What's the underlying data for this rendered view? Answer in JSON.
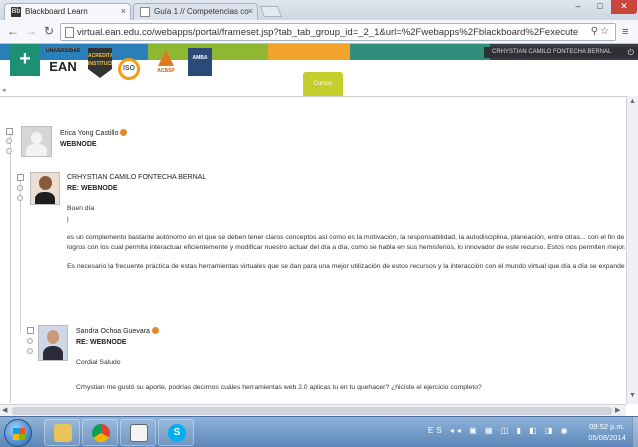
{
  "browser": {
    "tabs": [
      {
        "label": "Blackboard Learn",
        "icon": "bb-favicon"
      },
      {
        "label": "Guía 1 // Competencias co",
        "icon": "page-favicon"
      }
    ],
    "url": "virtual.ean.edu.co/webapps/portal/frameset.jsp?tab_tab_group_id=_2_1&url=%2Fwebapps%2Fblackboard%2Fexecute",
    "window_controls": {
      "minimize": "–",
      "maximize": "□",
      "close": "✕"
    }
  },
  "header": {
    "logos": {
      "ean": "EAN",
      "ean_caption": "UNIVERSIDAD",
      "badge": "ACREDITACIÓN INSTITUCIONAL",
      "circle": "ISO",
      "acbsp": "ACBSP",
      "ac2": "AMBA"
    },
    "user_name": "CRHYSTIAN CAMILO FONTECHA BERNAL",
    "active_tab": "Cursos",
    "colors": {
      "bar_blue": "#2a7fb8",
      "bar_green": "#8fb832",
      "bar_orange": "#f2a32b",
      "bar_teal": "#2f8f7a",
      "bar_dark": "#3a3d44",
      "tab_lime": "#c4cd2a",
      "plus_green": "#1d8f72"
    }
  },
  "posts": [
    {
      "author": "Erica Yong Castillo",
      "subject": "WEBNODE",
      "has_photo": false
    },
    {
      "author": "CRHYSTIAN CAMILO FONTECHA BERNAL",
      "subject": "RE: WEBNODE",
      "greeting": "Buen día",
      "body_line1": "es un complemento bastante autónomo en el que se deben tener claros conceptos así como es la motivación, la responsabilidad, la autodisciplina, planeación, entre otras... con el fin de adquirir",
      "body_line2": "logros con los cual permita interactuar eficientemente y modificar nuestro actuar del día a día, como se habla en sus hemisferios, lo innovador de este recurso. Estos nos permiten mejorar",
      "body_line3": "Es necesario la frecuente práctica de estas herramientas virtuales que se dan para una mejor utilización de estos recursos y la interacción con el mundo virtual que día a día se expande mas",
      "has_photo": true
    },
    {
      "author": "Sandra Ochoa Guevara",
      "subject": "RE: WEBNODE",
      "greeting": "Cordial Saludo",
      "body_line1": "Crhystian me gustó su aporte, podrías decirnos cuáles herramientas web 2.0 aplicas tu en tu quehacer? ¿hiciste el ejercicio completo?",
      "has_photo": true
    }
  ],
  "taskbar": {
    "apps": [
      "Windows Explorer",
      "Google Chrome",
      "Documento",
      "Skype"
    ],
    "tray_icons": "ES ◂◂ ▣ ▦ ◫ ▮ ◧ ◨ ◉",
    "time": "09:52 p.m.",
    "date": "05/08/2014"
  }
}
